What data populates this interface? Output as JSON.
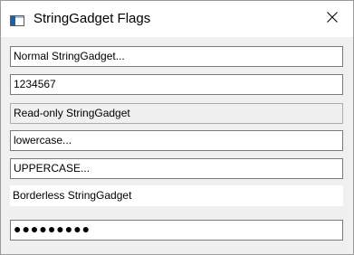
{
  "window": {
    "title": "StringGadget Flags",
    "close_glyph": "✕"
  },
  "gadgets": {
    "normal": "Normal StringGadget...",
    "numeric": "1234567",
    "readonly": "Read-only StringGadget",
    "lowercase": "lowercase...",
    "uppercase": "UPPERCASE...",
    "borderless": "Borderless StringGadget",
    "password": "●●●●●●●●●"
  },
  "colors": {
    "field_border": "#7a7a7a",
    "window_bg": "#f0f0f0",
    "title_bg": "#ffffff",
    "icon_blue": "#1e5fa8"
  }
}
